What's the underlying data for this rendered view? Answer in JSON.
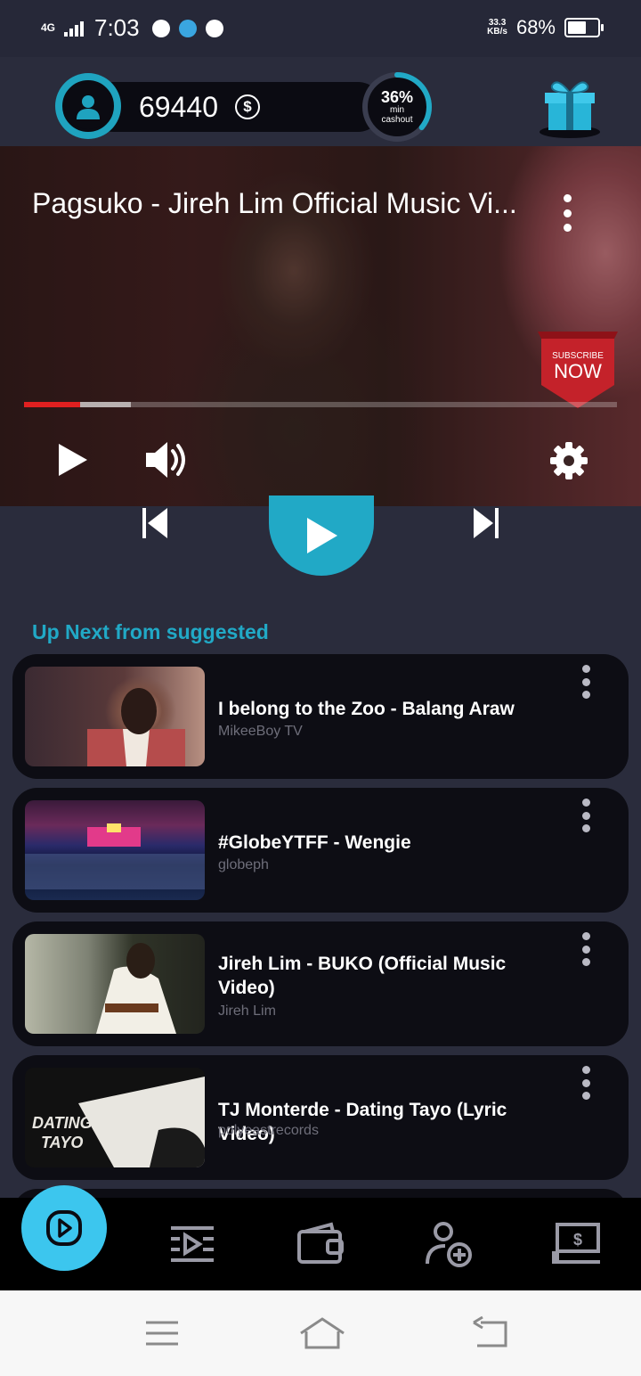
{
  "status_bar": {
    "network": "4G",
    "time": "7:03",
    "speed_value": "33.3",
    "speed_unit": "KB/s",
    "battery": "68%",
    "battery_level": 0.68
  },
  "header": {
    "coins": "69440",
    "currency_symbol": "$",
    "cashout_percent": "36%",
    "cashout_value": 0.36,
    "cashout_label_1": "min",
    "cashout_label_2": "cashout"
  },
  "player": {
    "title": "Pagsuko - Jireh Lim Official Music Vi...",
    "subscribe_top": "SUBSCRIBE",
    "subscribe_bottom": "NOW",
    "played_fraction": 0.095,
    "buffered_fraction": 0.18
  },
  "section_title": "Up Next from suggested",
  "videos": [
    {
      "title": "I belong to the Zoo - Balang Araw",
      "channel": "MikeeBoy TV"
    },
    {
      "title": "#GlobeYTFF - Wengie",
      "channel": "globeph"
    },
    {
      "title": "Jireh Lim - BUKO (Official Music Video)",
      "channel": "Jireh Lim"
    },
    {
      "title": "TJ Monterde - Dating Tayo (Lyric Video)",
      "channel": "polyeastrecords",
      "thumb_text_1": "DATING",
      "thumb_text_2": "TAYO"
    }
  ],
  "colors": {
    "accent": "#21a9c6",
    "nav_active": "#3cc6ee",
    "progress": "#e02020",
    "card_bg": "#0d0d14",
    "page_bg": "#2a2c3c"
  },
  "bottom_nav": [
    "player-icon",
    "playlist-icon",
    "wallet-icon",
    "add-user-icon",
    "cashout-icon"
  ]
}
